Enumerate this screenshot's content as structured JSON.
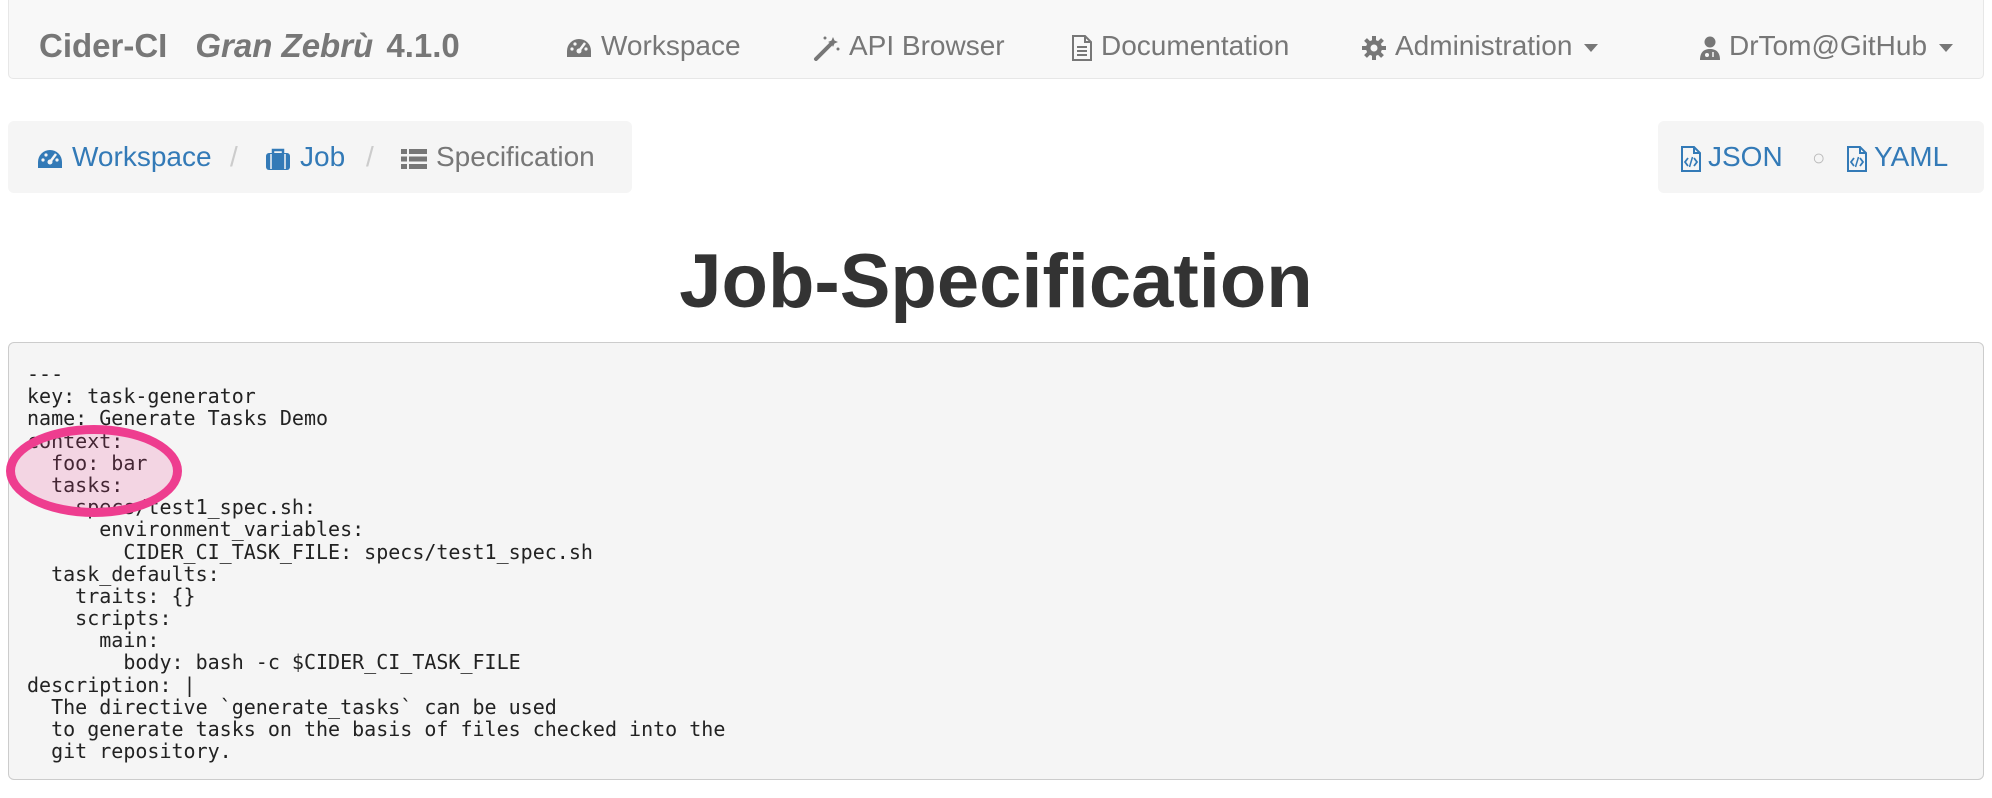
{
  "navbar": {
    "brand": "Cider-CI",
    "release_name": "Gran Zebrù",
    "version": "4.1.0",
    "items": [
      {
        "label": "Workspace",
        "icon": "dashboard-icon"
      },
      {
        "label": "API Browser",
        "icon": "magic-wand-icon"
      },
      {
        "label": "Documentation",
        "icon": "document-icon"
      },
      {
        "label": "Administration",
        "icon": "gear-icon",
        "dropdown": true
      }
    ],
    "user": {
      "label": "DrTom@GitHub",
      "icon": "user-doctor-icon",
      "dropdown": true
    }
  },
  "breadcrumb": [
    {
      "label": "Workspace",
      "icon": "dashboard-icon",
      "link": true
    },
    {
      "label": "Job",
      "icon": "briefcase-icon",
      "link": true
    },
    {
      "label": "Specification",
      "icon": "list-icon",
      "link": false
    }
  ],
  "breadcrumb_separator": "/",
  "formats": {
    "json_label": "JSON",
    "yaml_label": "YAML",
    "separator": "○",
    "icon": "code-file-icon"
  },
  "title": "Job-Specification",
  "spec_lines": [
    "---",
    "key: task-generator",
    "name: Generate Tasks Demo",
    "context:",
    "  foo: bar",
    "  tasks:",
    "    specs/test1_spec.sh:",
    "      environment_variables:",
    "        CIDER_CI_TASK_FILE: specs/test1_spec.sh",
    "  task_defaults:",
    "    traits: {}",
    "    scripts:",
    "      main:",
    "        body: bash -c $CIDER_CI_TASK_FILE",
    "description: |",
    "  The directive `generate_tasks` can be used",
    "  to generate tasks on the basis of files checked into the",
    "  git repository."
  ],
  "colors": {
    "link": "#337ab7",
    "navbar_text": "#777777",
    "highlight": "#ee3d8f"
  }
}
